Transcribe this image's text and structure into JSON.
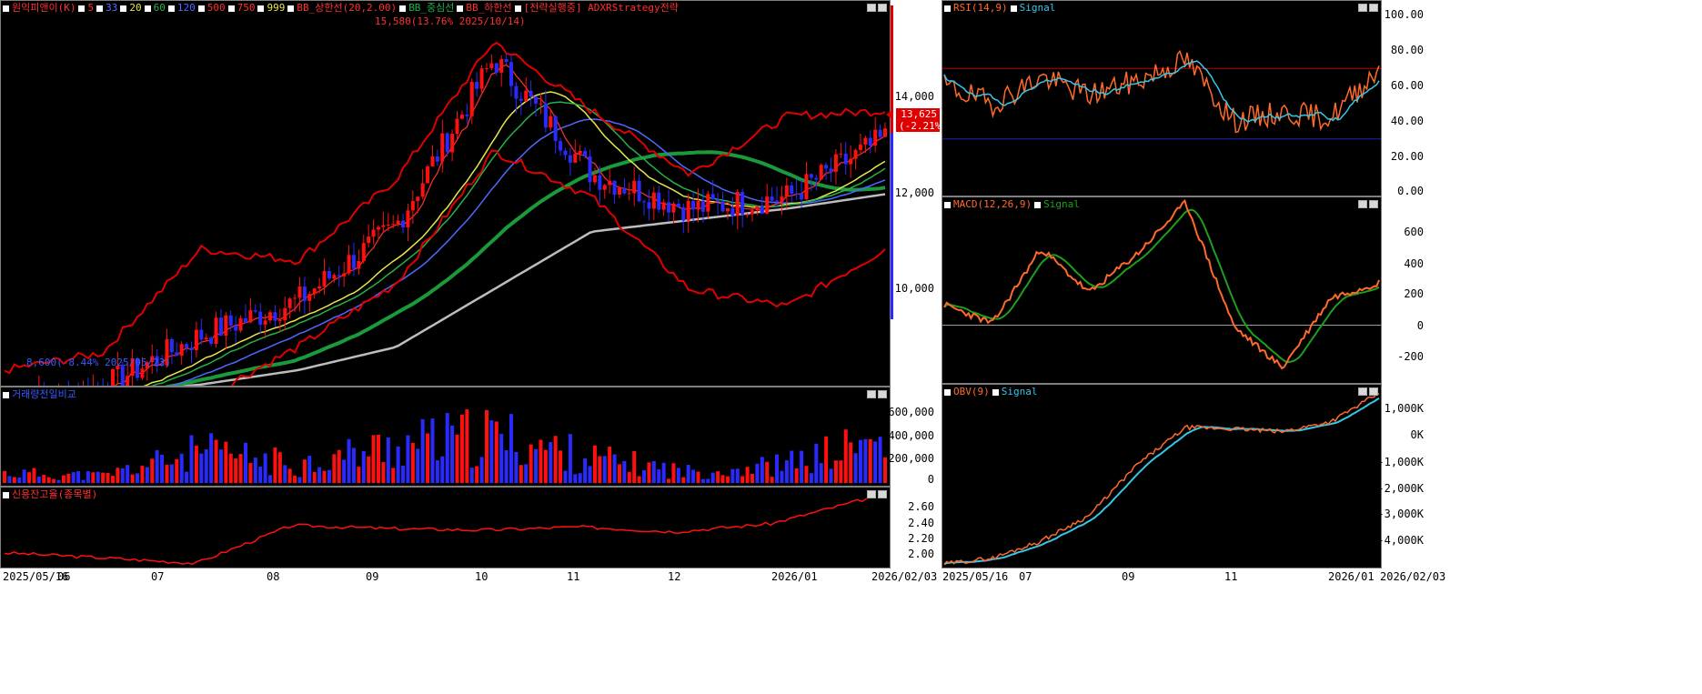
{
  "colors": {
    "up": "#ff1010",
    "down": "#2a2aff",
    "bb": "#e00000",
    "mid": "#1a9a3a",
    "ma5": "#ff3030",
    "ma33": "#5a6aff",
    "ma20": "#e7e74a",
    "ma60": "#24b24a",
    "ma120": "#4f68ff",
    "ma999": "#bdbdbd",
    "signal": "#39c6e6",
    "rsi": "#ff6a2a",
    "macd": "#ff6a2a",
    "macdsig": "#1e9e1e",
    "obv": "#ff6a2a"
  },
  "main_panel": {
    "legend": [
      {
        "label": "원익피앤이(K)",
        "color": "#ff3030"
      },
      {
        "label": "5",
        "color": "#ff3030"
      },
      {
        "label": "33",
        "color": "#5a6aff"
      },
      {
        "label": "20",
        "color": "#e7e74a"
      },
      {
        "label": "60",
        "color": "#24b24a"
      },
      {
        "label": "120",
        "color": "#4f68ff"
      },
      {
        "label": "500",
        "color": "#ff3030"
      },
      {
        "label": "750",
        "color": "#ff3030"
      },
      {
        "label": "999",
        "color": "#e7e74a"
      },
      {
        "label": "BB_상한선(20,2.00)",
        "color": "#ff3030"
      },
      {
        "label": "BB_중심선",
        "color": "#24b24a"
      },
      {
        "label": "BB_하한선",
        "color": "#ff3030"
      },
      {
        "label": "[전략실행중] ADXRStrategy전략",
        "color": "#ff3030"
      }
    ],
    "high_annotation": "15,580(13.76% 2025/10/14)",
    "low_annotation": "8,600(-8.44% 2025/05/23)",
    "price_ticks": [
      "14,000",
      "12,000",
      "10,000"
    ],
    "last_price": "13,625",
    "last_change": "(-2.21%)"
  },
  "volume_panel": {
    "title": "거래량전일비교",
    "ticks": [
      "600,000",
      "400,000",
      "200,000",
      "0"
    ]
  },
  "credit_panel": {
    "title": "신용잔고율(종목별)",
    "ticks": [
      "2.60",
      "2.40",
      "2.20",
      "2.00"
    ]
  },
  "rsi_panel": {
    "title": "RSI(14,9)",
    "signal_label": "Signal",
    "ticks": [
      "100.00",
      "80.00",
      "60.00",
      "40.00",
      "20.00",
      "0.00"
    ]
  },
  "macd_panel": {
    "title": "MACD(12,26,9)",
    "signal_label": "Signal",
    "ticks": [
      "600",
      "400",
      "200",
      "0",
      "-200"
    ]
  },
  "obv_panel": {
    "title": "OBV(9)",
    "signal_label": "Signal",
    "ticks": [
      "1,000K",
      "0K",
      "-1,000K",
      "-2,000K",
      "-3,000K",
      "-4,000K"
    ]
  },
  "left_xaxis": [
    "2025/05/16",
    "06",
    "07",
    "08",
    "09",
    "10",
    "11",
    "12",
    "2026/01",
    "2026/02/03"
  ],
  "right_xaxis": [
    "2025/05/16",
    "07",
    "09",
    "11",
    "2026/01",
    "2026/02/03"
  ],
  "chart_data": [
    {
      "type": "line",
      "title": "원익피앤이(K)",
      "y_label": "price",
      "ylim": [
        9300,
        16000
      ],
      "x": [
        "2025/05",
        "2025/06",
        "2025/07",
        "2025/08",
        "2025/09",
        "2025/10",
        "2025/11",
        "2025/12",
        "2026/01",
        "2026/02"
      ],
      "series": [
        {
          "name": "원익피앤이(K)",
          "values": [
            9000,
            9300,
            10200,
            10800,
            12100,
            15000,
            13000,
            12400,
            12600,
            13625
          ]
        },
        {
          "name": "BB_상한선",
          "values": [
            9600,
            9900,
            11700,
            11500,
            12900,
            15300,
            14100,
            13000,
            14000,
            14100
          ]
        },
        {
          "name": "BB_하한선",
          "values": [
            8500,
            8700,
            9100,
            10000,
            11100,
            13400,
            12600,
            11000,
            10700,
            11700
          ]
        },
        {
          "name": "999",
          "values": [
            9050,
            9200,
            9350,
            9600,
            10000,
            11000,
            12000,
            12200,
            12400,
            12650
          ]
        }
      ],
      "annotations": [
        "15,580(13.76% 2025/10/14)",
        "8,600(-8.44% 2025/05/23)"
      ]
    },
    {
      "type": "bar",
      "title": "거래량전일비교",
      "ylim": [
        0,
        700000
      ],
      "categories": [
        "2025/05",
        "2025/06",
        "2025/07",
        "2025/08",
        "2025/09",
        "2025/10",
        "2025/11",
        "2025/12",
        "2026/01",
        "2026/02"
      ],
      "values": [
        80000,
        60000,
        250000,
        150000,
        300000,
        380000,
        200000,
        90000,
        150000,
        350000
      ]
    },
    {
      "type": "line",
      "title": "신용잔고율(종목별)",
      "ylim": [
        1.9,
        2.8
      ],
      "x": [
        "2025/05",
        "2025/06",
        "2025/07",
        "2025/08",
        "2025/09",
        "2025/10",
        "2025/11",
        "2025/12",
        "2026/01",
        "2026/02"
      ],
      "values": [
        2.06,
        2.0,
        1.93,
        2.4,
        2.36,
        2.34,
        2.38,
        2.32,
        2.42,
        2.73
      ]
    },
    {
      "type": "line",
      "title": "RSI(14,9)",
      "ylim": [
        0,
        100
      ],
      "x": [
        "2025/05",
        "2025/06",
        "2025/07",
        "2025/08",
        "2025/09",
        "2025/10",
        "2025/11",
        "2025/12",
        "2026/01",
        "2026/02"
      ],
      "series": [
        {
          "name": "RSI",
          "values": [
            60,
            50,
            65,
            55,
            63,
            75,
            40,
            45,
            42,
            70
          ]
        },
        {
          "name": "Signal",
          "values": [
            60,
            52,
            62,
            56,
            61,
            70,
            44,
            42,
            44,
            58
          ]
        }
      ]
    },
    {
      "type": "line",
      "title": "MACD(12,26,9)",
      "ylim": [
        -350,
        750
      ],
      "x": [
        "2025/05",
        "2025/06",
        "2025/07",
        "2025/08",
        "2025/09",
        "2025/10",
        "2025/11",
        "2025/12",
        "2026/01",
        "2026/02"
      ],
      "series": [
        {
          "name": "MACD",
          "values": [
            120,
            10,
            450,
            190,
            420,
            720,
            -10,
            -250,
            160,
            250
          ]
        },
        {
          "name": "Signal",
          "values": [
            100,
            20,
            300,
            200,
            380,
            620,
            30,
            -200,
            0,
            140
          ]
        }
      ]
    },
    {
      "type": "line",
      "title": "OBV(9)",
      "ylim": [
        -4800,
        1600
      ],
      "x": [
        "2025/05",
        "2025/06",
        "2025/07",
        "2025/08",
        "2025/09",
        "2025/10",
        "2025/11",
        "2025/12",
        "2026/01",
        "2026/02"
      ],
      "series": [
        {
          "name": "OBV",
          "values": [
            -4700,
            -4500,
            -3900,
            -3000,
            -1200,
            100,
            50,
            -50,
            300,
            1300
          ]
        },
        {
          "name": "Signal",
          "values": [
            -4700,
            -4550,
            -4000,
            -3100,
            -1400,
            -100,
            0,
            -20,
            250,
            800
          ]
        }
      ]
    }
  ]
}
